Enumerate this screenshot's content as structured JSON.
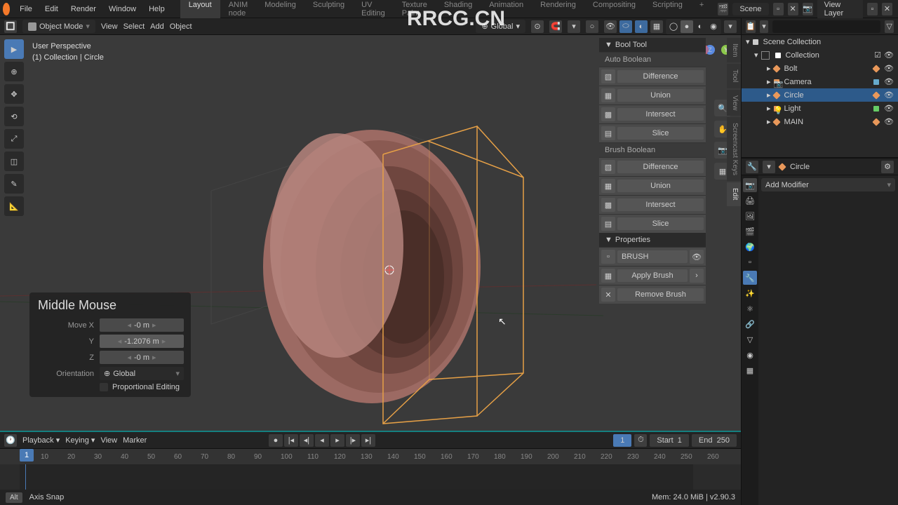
{
  "topbar": {
    "menus": [
      "File",
      "Edit",
      "Render",
      "Window",
      "Help"
    ],
    "tabs": [
      "Layout",
      "ANIM node",
      "Modeling",
      "Sculpting",
      "UV Editing",
      "Texture Paint",
      "Shading",
      "Animation",
      "Rendering",
      "Compositing",
      "Scripting"
    ],
    "scene_label": "Scene",
    "viewlayer_label": "View Layer"
  },
  "vphdr": {
    "mode": "Object Mode",
    "menus": [
      "View",
      "Select",
      "Add",
      "Object"
    ],
    "orientation": "Global"
  },
  "viewport": {
    "info1": "User Perspective",
    "info2": "(1) Collection | Circle"
  },
  "npanel": {
    "title": "Bool Tool",
    "section_auto": "Auto Boolean",
    "auto": [
      "Difference",
      "Union",
      "Intersect",
      "Slice"
    ],
    "section_brush": "Brush Boolean",
    "brush": [
      "Difference",
      "Union",
      "Intersect",
      "Slice"
    ],
    "properties": "Properties",
    "brush_label": "BRUSH",
    "apply": "Apply Brush",
    "remove": "Remove Brush",
    "tabs": [
      "Item",
      "Tool",
      "View",
      "Screencast Keys",
      "Edit"
    ]
  },
  "panel": {
    "title": "Middle Mouse",
    "move_x": "Move X",
    "x": "-0 m",
    "y_lab": "Y",
    "y": "-1.2076 m",
    "z_lab": "Z",
    "z": "-0 m",
    "orient": "Orientation",
    "orient_val": "Global",
    "prop": "Proportional Editing"
  },
  "outliner": {
    "scene": "Scene Collection",
    "coll": "Collection",
    "items": [
      "Bolt",
      "Camera",
      "Circle",
      "Light",
      "MAIN"
    ]
  },
  "props": {
    "obj": "Circle",
    "add": "Add Modifier"
  },
  "timeline": {
    "menus": [
      "Playback",
      "Keying",
      "View",
      "Marker"
    ],
    "frame": "1",
    "start_l": "Start",
    "start_v": "1",
    "end_l": "End",
    "end_v": "250",
    "cursor": "1",
    "ticks": [
      "10",
      "20",
      "30",
      "40",
      "50",
      "60",
      "70",
      "80",
      "90",
      "100",
      "110",
      "120",
      "130",
      "140",
      "150",
      "160",
      "170",
      "180",
      "190",
      "200",
      "210",
      "220",
      "230",
      "240",
      "250",
      "260"
    ]
  },
  "status": {
    "key": "Alt",
    "msg": "Axis Snap",
    "mem": "Mem: 24.0 MiB | v2.90.3"
  },
  "watermark_main": "RRCG.CN"
}
